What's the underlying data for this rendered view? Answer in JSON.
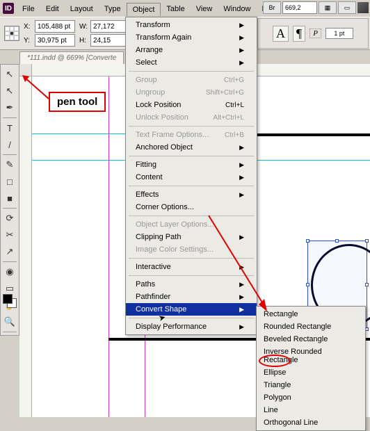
{
  "app": {
    "icon_label": "ID"
  },
  "menubar": [
    "File",
    "Edit",
    "Layout",
    "Type",
    "Object",
    "Table",
    "View",
    "Window",
    "Help"
  ],
  "active_menu_index": 4,
  "top_right": {
    "zoom": "669,2",
    "stroke": "1 pt"
  },
  "controlbar": {
    "x": "105,488 pt",
    "y": "30,975 pt",
    "w": "27,172",
    "h": "24,15"
  },
  "doc_tab": "*111.indd @ 669% [Converte",
  "callout": "pen tool",
  "tools": [
    {
      "glyph": "↖",
      "name": "selection-tool"
    },
    {
      "glyph": "↖",
      "name": "direct-selection-tool"
    },
    {
      "glyph": "✒",
      "name": "pen-tool",
      "sep_after": true
    },
    {
      "glyph": "T",
      "name": "type-tool"
    },
    {
      "glyph": "/",
      "name": "line-tool",
      "sep_after": true
    },
    {
      "glyph": "✎",
      "name": "pencil-tool"
    },
    {
      "glyph": "□",
      "name": "rectangle-frame-tool"
    },
    {
      "glyph": "■",
      "name": "rectangle-tool",
      "sep_after": true
    },
    {
      "glyph": "⟳",
      "name": "rotate-tool"
    },
    {
      "glyph": "✂",
      "name": "scissors-tool"
    },
    {
      "glyph": "↗",
      "name": "free-transform-tool",
      "sep_after": true
    },
    {
      "glyph": "◉",
      "name": "gradient-tool"
    },
    {
      "glyph": "▭",
      "name": "note-tool"
    },
    {
      "glyph": "✋",
      "name": "hand-tool"
    },
    {
      "glyph": "🔍",
      "name": "zoom-tool",
      "sep_after": true
    }
  ],
  "object_menu": [
    {
      "label": "Transform",
      "arrow": true
    },
    {
      "label": "Transform Again",
      "arrow": true
    },
    {
      "label": "Arrange",
      "arrow": true
    },
    {
      "label": "Select",
      "arrow": true,
      "sep_after": true
    },
    {
      "label": "Group",
      "shortcut": "Ctrl+G",
      "disabled": true
    },
    {
      "label": "Ungroup",
      "shortcut": "Shift+Ctrl+G",
      "disabled": true
    },
    {
      "label": "Lock Position",
      "shortcut": "Ctrl+L"
    },
    {
      "label": "Unlock Position",
      "shortcut": "Alt+Ctrl+L",
      "disabled": true,
      "sep_after": true
    },
    {
      "label": "Text Frame Options...",
      "shortcut": "Ctrl+B",
      "disabled": true
    },
    {
      "label": "Anchored Object",
      "arrow": true,
      "sep_after": true
    },
    {
      "label": "Fitting",
      "arrow": true
    },
    {
      "label": "Content",
      "arrow": true,
      "sep_after": true
    },
    {
      "label": "Effects",
      "arrow": true
    },
    {
      "label": "Corner Options...",
      "sep_after": true
    },
    {
      "label": "Object Layer Options...",
      "disabled": true
    },
    {
      "label": "Clipping Path",
      "arrow": true
    },
    {
      "label": "Image Color Settings...",
      "disabled": true,
      "sep_after": true
    },
    {
      "label": "Interactive",
      "arrow": true,
      "sep_after": true
    },
    {
      "label": "Paths",
      "arrow": true
    },
    {
      "label": "Pathfinder",
      "arrow": true
    },
    {
      "label": "Convert Shape",
      "arrow": true,
      "highlight": true,
      "sep_after": true
    },
    {
      "label": "Display Performance",
      "arrow": true
    }
  ],
  "convert_shape_submenu": [
    "Rectangle",
    "Rounded Rectangle",
    "Beveled Rectangle",
    "Inverse Rounded Rectangle",
    "Ellipse",
    "Triangle",
    "Polygon",
    "Line",
    "Orthogonal Line"
  ],
  "circled_submenu_index": 4
}
